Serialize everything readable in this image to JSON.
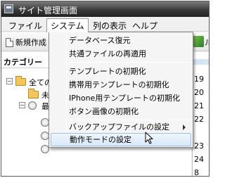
{
  "window": {
    "title": "サイト管理画面"
  },
  "menubar": {
    "items": [
      {
        "label": "ファイル"
      },
      {
        "label": "システム"
      },
      {
        "label": "列の表示"
      },
      {
        "label": "ヘルプ"
      }
    ],
    "active_index": 1
  },
  "toolbar": {
    "new_label": "新規作成",
    "right_label": "ル"
  },
  "left_panel": {
    "header": "カテゴリー",
    "tree": [
      {
        "label": "全ての"
      },
      {
        "label": "未"
      },
      {
        "label": "最"
      }
    ]
  },
  "right_panel": {
    "numbers": [
      "19",
      "20",
      "21",
      "22",
      "23",
      "24",
      "8"
    ]
  },
  "system_menu": {
    "items": [
      {
        "label": "データベース復元"
      },
      {
        "label": "共通ファイルの再適用"
      },
      {
        "label": "テンプレートの初期化"
      },
      {
        "label": "携帯用テンプレートの初期化"
      },
      {
        "label": "IPhone用テンプレートの初期化"
      },
      {
        "label": "ボタン画像の初期化"
      },
      {
        "label": "バックアップファイルの設定"
      },
      {
        "label": "動作モードの設定"
      }
    ],
    "hovered_index": 7
  },
  "colors": {
    "title_bar": "#2a2a2a",
    "menu_hover": "#d9e8f9",
    "menu_hover_border": "#9fbfe3"
  }
}
